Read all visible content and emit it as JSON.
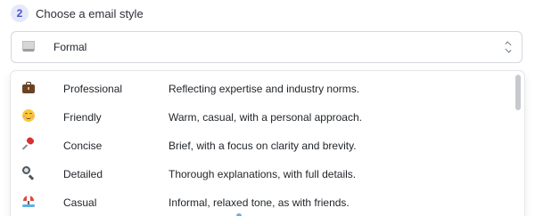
{
  "step": {
    "number": "2",
    "title": "Choose a email style"
  },
  "select": {
    "icon": "page-icon",
    "value": "Formal"
  },
  "options": [
    {
      "icon": "briefcase-icon",
      "name": "Professional",
      "description": "Reflecting expertise and industry norms."
    },
    {
      "icon": "smiling-face-icon",
      "name": "Friendly",
      "description": "Warm, casual, with a personal approach."
    },
    {
      "icon": "pushpin-icon",
      "name": "Concise",
      "description": "Brief, with a focus on clarity and brevity."
    },
    {
      "icon": "magnifying-glass-icon",
      "name": "Detailed",
      "description": "Thorough explanations, with full details."
    },
    {
      "icon": "beach-umbrella-icon",
      "name": "Casual",
      "description": "Informal, relaxed tone, as with friends."
    }
  ],
  "colors": {
    "step_badge_bg": "#e6e8fb",
    "step_badge_text": "#4b55c9",
    "border": "#d4d7dd"
  }
}
